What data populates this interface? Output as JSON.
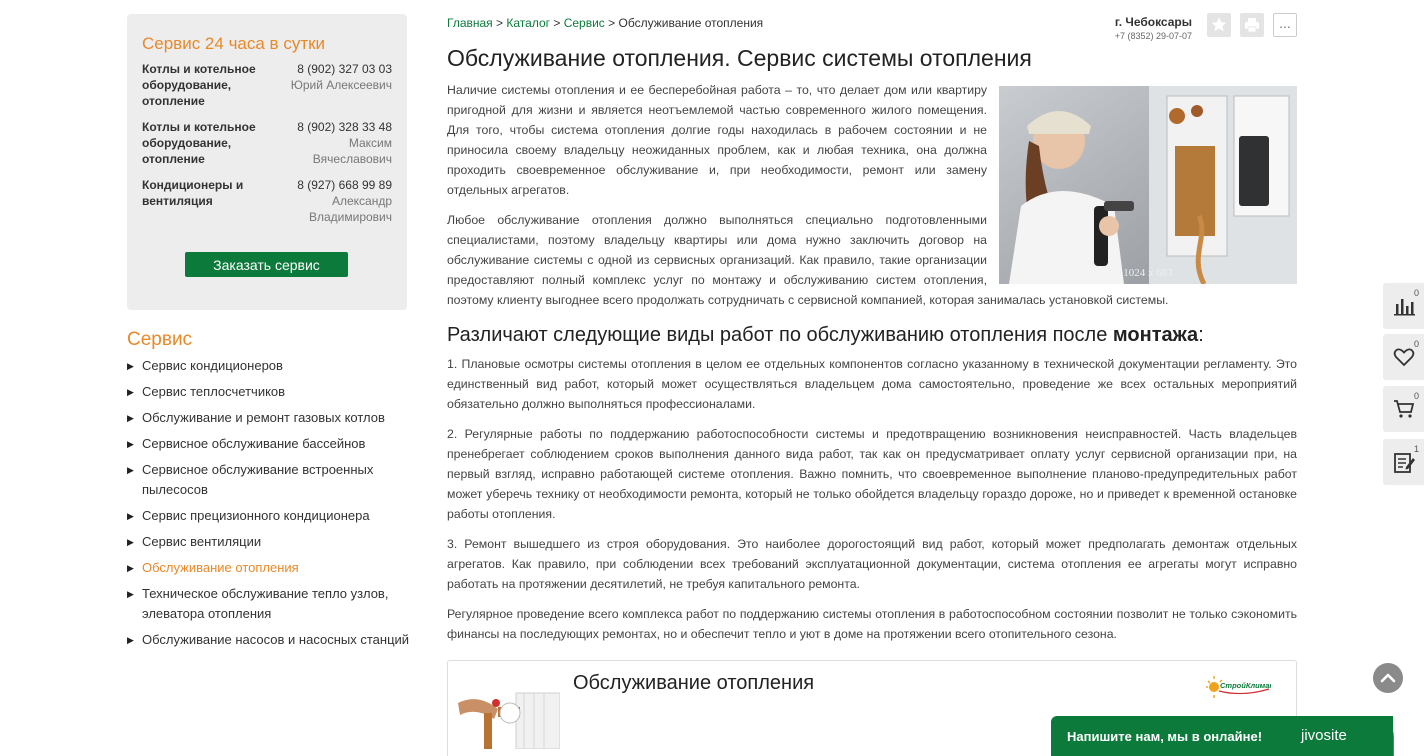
{
  "sidebar": {
    "service_box": {
      "title": "Сервис 24 часа в сутки",
      "rows": [
        {
          "category": "Котлы и котельное оборудование, отопление",
          "phone": "8 (902) 327 03 03",
          "person": "Юрий Алексеевич"
        },
        {
          "category": "Котлы и котельное оборудование, отопление",
          "phone": "8 (902) 328 33 48",
          "person": "Максим Вячеславович"
        },
        {
          "category": "Кондиционеры и вентиляция",
          "phone": "8 (927) 668 99 89",
          "person": "Александр Владимирович"
        }
      ],
      "order_button": "Заказать сервис"
    },
    "menu_title": "Сервис",
    "bullet": "▶",
    "menu": [
      {
        "label": "Сервис кондиционеров"
      },
      {
        "label": "Сервис теплосчетчиков"
      },
      {
        "label": "Обслуживание и ремонт газовых котлов"
      },
      {
        "label": "Сервисное обслуживание бассейнов"
      },
      {
        "label": "Сервисное обслуживание встроенных пылесосов"
      },
      {
        "label": "Сервис прецизионного кондиционера"
      },
      {
        "label": "Сервис вентиляции"
      },
      {
        "label": "Обслуживание отопления"
      },
      {
        "label": "Техническое обслуживание тепло узлов, элеватора отопления"
      },
      {
        "label": "Обслуживание насосов и насосных станций"
      }
    ],
    "active_index": 7
  },
  "header": {
    "breadcrumb": [
      "Главная",
      "Каталог",
      "Сервис",
      "Обслуживание отопления"
    ],
    "breadcrumb_sep": ">",
    "city": "г. Чебоксары",
    "phone": "+7 (8352) 29-07-07",
    "more_button": "..."
  },
  "page": {
    "title": "Обслуживание отопления. Сервис системы отопления",
    "image_caption": "1024 x 683",
    "paragraphs": [
      "Наличие системы отопления и ее бесперебойная работа – то, что делает дом или квартиру пригодной для жизни и является неотъемлемой частью современного жилого помещения. Для того, чтобы система отопления долгие годы находилась в рабочем состоянии и не приносила своему владельцу неожиданных проблем, как и любая техника, она должна проходить своевременное обслуживание и, при необходимости, ремонт или замену отдельных агрегатов.",
      "Любое обслуживание отопления должно выполняться специально подготовленными специалистами, поэтому владельцу квартиры или дома нужно заключить договор на обслуживание системы с одной из сервисных организаций. Как правило, такие организации предоставляют полный комплекс услуг по монтажу и обслуживанию систем отопления, поэтому клиенту выгоднее всего продолжать сотрудничать с сервисной компанией, которая занималась установкой системы."
    ],
    "subheading_pre": "Различают следующие виды работ по обслуживанию отопления после ",
    "subheading_bold": "монтажа",
    "subheading_post": ":",
    "list_paragraphs": [
      "1. Плановые осмотры системы отопления в целом ее отдельных компонентов согласно указанному в технической документации регламенту. Это единственный вид работ, который может осуществляться владельцем дома самостоятельно, проведение же всех остальных мероприятий обязательно должно выполняться профессионалами.",
      "2. Регулярные работы по поддержанию работоспособности системы и предотвращению возникновения неисправностей. Часть владельцев пренебрегает соблюдением сроков выполнения данного вида работ, так как он предусматривает оплату услуг сервисной организации при, на первый взгляд, исправно работающей системе отопления. Важно помнить, что своевременное выполнение планово-предупредительных работ может уберечь технику от необходимости ремонта, который не только обойдется владельцу гораздо дороже, но и приведет к временной остановке работы отопления.",
      "3. Ремонт вышедшего из строя оборудования. Это наиболее дорогостоящий вид работ, который может предполагать демонтаж отдельных агрегатов. Как правило, при соблюдении всех требований эксплуатационной документации, система отопления ее агрегаты могут исправно работать на протяжении десятилетий, не требуя капитального ремонта.",
      "Регулярное проведение всего комплекса работ по поддержанию системы отопления в работоспособном состоянии позволит не только сэкономить финансы на последующих ремонтах, но и обеспечит тепло и уют в доме на протяжении всего отопительного сезона."
    ],
    "card_title": "Обслуживание отопления",
    "card_logo_text": "СтройКлимат"
  },
  "widgets": {
    "compare_count": "0",
    "favorites_count": "0",
    "cart_count": "0",
    "orders_count": "1"
  },
  "chat": {
    "text": "Напишите нам, мы в онлайне!",
    "brand": "jivosite"
  },
  "colors": {
    "accent_orange": "#e8892a",
    "brand_green": "#0b7a3b",
    "panel_gray": "#ededed"
  }
}
